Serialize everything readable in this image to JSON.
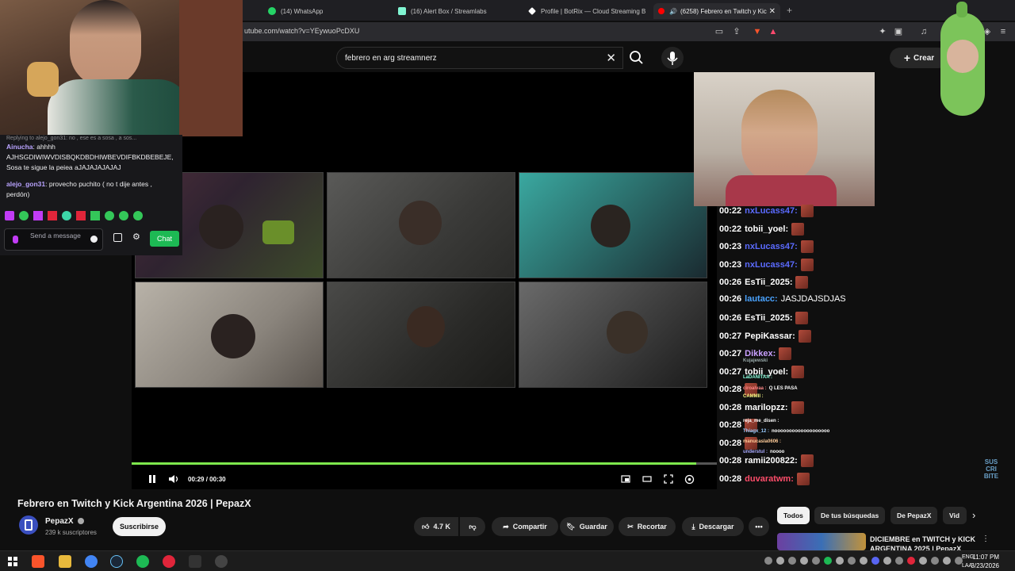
{
  "browser": {
    "tabs": [
      {
        "label": "(14) WhatsApp",
        "color": "#25d366"
      },
      {
        "label": "(16) Alert Box / Streamlabs",
        "color": "#80f5d2"
      },
      {
        "label": "Profile | BotRix — Cloud Streaming B",
        "color": "#ffffff"
      },
      {
        "label": "(6258) Febrero en Twitch y Kic",
        "color": "#ff0000"
      }
    ],
    "url": "utube.com/watch?v=YEywuoPcDXU"
  },
  "search": {
    "query": "febrero en arg streamnerz"
  },
  "header": {
    "create_label": "Crear"
  },
  "player": {
    "time_current": "00:29",
    "time_total": "00:30",
    "time_separator": "/",
    "progress": 0.97
  },
  "overlay_chat": [
    {
      "time": "00:22",
      "user": "nxLucass47:",
      "color": "#5b6bff",
      "text": ""
    },
    {
      "time": "00:22",
      "user": "tobii_yoel:",
      "color": "#ffffff",
      "text": ""
    },
    {
      "time": "00:23",
      "user": "nxLucass47:",
      "color": "#5b6bff",
      "text": ""
    },
    {
      "time": "00:23",
      "user": "nxLucass47:",
      "color": "#5b6bff",
      "text": ""
    },
    {
      "time": "00:26",
      "user": "EsTii_2025:",
      "color": "#ffffff",
      "text": ""
    },
    {
      "time": "00:26",
      "user": "lautacc:",
      "color": "#4aa3ff",
      "text": "JASJDAJSDJAS"
    },
    {
      "time": "00:26",
      "user": "EsTii_2025:",
      "color": "#ffffff",
      "text": ""
    },
    {
      "time": "00:27",
      "user": "PepiKassar:",
      "color": "#ffffff",
      "text": ""
    },
    {
      "time": "00:27",
      "user": "Dikkex:",
      "color": "#c9a0ff",
      "text": ""
    },
    {
      "time": "00:27",
      "user": "tobii_yoel:",
      "color": "#ffffff",
      "text": ""
    },
    {
      "time": "00:28",
      "user": "",
      "color": "#ffffff",
      "text": ""
    },
    {
      "time": "00:28",
      "user": "marilopzz:",
      "color": "#ffffff",
      "text": ""
    },
    {
      "time": "00:28",
      "user": "",
      "color": "#ffffff",
      "text": ""
    },
    {
      "time": "00:28",
      "user": "",
      "color": "#ffffff",
      "text": ""
    },
    {
      "time": "00:28",
      "user": "ramii200822:",
      "color": "#ffffff",
      "text": ""
    },
    {
      "time": "00:28",
      "user": "duvaratwm:",
      "color": "#ff4d6a",
      "text": ""
    }
  ],
  "overlay_mini_chat": [
    {
      "user": "Kujajewski",
      "text": ""
    },
    {
      "user": "LaDANITAA :",
      "text": ""
    },
    {
      "user": "ciroalvaa :",
      "text": "Q LES PASA"
    },
    {
      "user": "CAMMII :",
      "text": ""
    },
    {
      "user": "reja_me_disen :",
      "text": ""
    },
    {
      "user": "Thiagx_12 :",
      "text": "nooooooooooooooooooo"
    },
    {
      "user": "manucasla0606 :",
      "text": ""
    },
    {
      "user": "understul :",
      "text": "noooo"
    }
  ],
  "twitch_chat": {
    "replying": "Replying to alejo_gon31: no , ese es a sosa , a sos...",
    "messages": [
      {
        "user": "Ainucha",
        "color": "#b9a3ff",
        "text": "ahhhh AJHSGDIWIWVDISBQKDBDHIWBEVDIFBKDBEBEJE, Sosa te sigue la peiea aJAJAJAJAJAJ"
      },
      {
        "user": "alejo_gon31",
        "color": "#b9a3ff",
        "text": "provecho puchito ( no t dije antes , perdón)"
      }
    ],
    "input_placeholder": "Send a message",
    "chat_button": "Chat"
  },
  "video": {
    "title": "Febrero en Twitch y Kick Argentina 2026 | PepazX",
    "channel": "PepazX",
    "subscribers": "239 k suscriptores",
    "subscribe_label": "Suscribirse",
    "likes": "4.7 K",
    "share_label": "Compartir",
    "save_label": "Guardar",
    "clip_label": "Recortar",
    "download_label": "Descargar"
  },
  "watermark": "SUS CRI BITE",
  "chips": [
    "Todos",
    "De tus búsquedas",
    "De PepazX",
    "Vid"
  ],
  "recommended": {
    "title": "DICIEMBRE en TWITCH y KICK ARGENTINA 2025 | PepazX"
  },
  "taskbar": {
    "lang_line1": "ENG",
    "lang_line2": "LAA",
    "time": "11:07 PM",
    "date": "3/23/2026"
  },
  "colors": {
    "accent_green": "#7ee84d",
    "youtube_red": "#ff0000",
    "twitch_purple": "#9146ff"
  }
}
